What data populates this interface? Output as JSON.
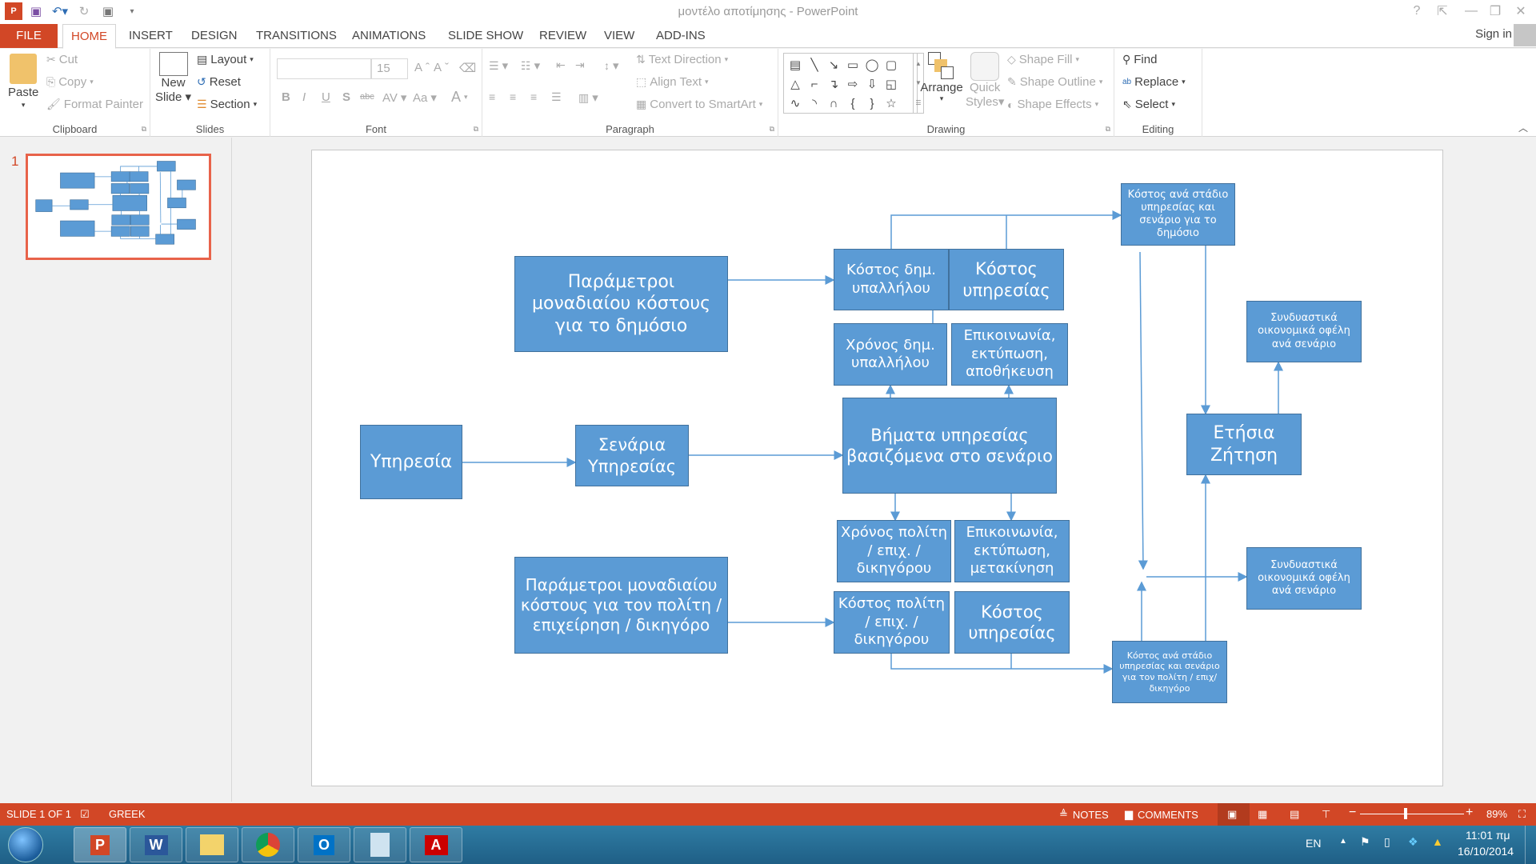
{
  "app": {
    "window_title": "μοντέλο αποτίμησης - PowerPoint",
    "quick_access": [
      "powerpoint-logo-icon",
      "save-icon",
      "undo-icon",
      "redo-icon",
      "start-from-beginning-icon",
      "customize-qat-icon"
    ],
    "window_controls": {
      "help": "?",
      "ribbon_display": "⇱",
      "minimize": "—",
      "restore": "❐",
      "close": "✕"
    },
    "sign_in": "Sign in"
  },
  "tabs": [
    {
      "label": "FILE"
    },
    {
      "label": "HOME",
      "active": true
    },
    {
      "label": "INSERT"
    },
    {
      "label": "DESIGN"
    },
    {
      "label": "TRANSITIONS"
    },
    {
      "label": "ANIMATIONS"
    },
    {
      "label": "SLIDE SHOW"
    },
    {
      "label": "REVIEW"
    },
    {
      "label": "VIEW"
    },
    {
      "label": "ADD-INS"
    }
  ],
  "ribbon": {
    "clipboard": {
      "label": "Clipboard",
      "paste": "Paste",
      "cut": "Cut",
      "copy": "Copy",
      "format_painter": "Format Painter"
    },
    "slides": {
      "label": "Slides",
      "new_slide_1": "New",
      "new_slide_2": "Slide",
      "layout": "Layout",
      "reset": "Reset",
      "section": "Section"
    },
    "font": {
      "label": "Font",
      "font_name": "",
      "font_size": "15",
      "bold": "B",
      "italic": "I",
      "underline": "U",
      "shadow": "S",
      "strike": "abc",
      "spacing": "AV",
      "case": "Aa",
      "color": "A",
      "grow": "A",
      "shrink": "A"
    },
    "paragraph": {
      "label": "Paragraph",
      "text_direction": "Text Direction",
      "align_text": "Align Text",
      "convert_smartart": "Convert to SmartArt"
    },
    "drawing": {
      "label": "Drawing",
      "arrange": "Arrange",
      "quick_styles_1": "Quick",
      "quick_styles_2": "Styles",
      "shape_fill": "Shape Fill",
      "shape_outline": "Shape Outline",
      "shape_effects": "Shape Effects",
      "shapes": [
        "▤",
        "╲",
        "↘",
        "▭",
        "◯",
        "▢",
        "△",
        "⌐",
        "↴",
        "⇨",
        "⇩",
        "◱",
        "∿",
        "◝",
        "∩",
        "{",
        "}",
        "☆"
      ]
    },
    "editing": {
      "label": "Editing",
      "find": "Find",
      "replace": "Replace",
      "select": "Select"
    }
  },
  "thumbnails": [
    {
      "number": "1",
      "selected": true
    }
  ],
  "diagram": {
    "boxes": {
      "ypiresia": "Υπηρεσία",
      "senaria": "Σενάρια Υπηρεσίας",
      "params_public": "Παράμετροι μοναδιαίου κόστους για το δημόσιο",
      "params_citizen": "Παράμετροι μοναδιαίου κόστους για τον πολίτη / επιχείρηση / δικηγόρο",
      "steps": "Βήματα υπηρεσίας βασιζόμενα στο σενάριο",
      "cost_employee": "Κόστος δημ. υπαλλήλου",
      "cost_service_top": "Κόστος υπηρεσίας",
      "time_employee": "Χρόνος δημ. υπαλλήλου",
      "comm_storage": "Επικοινωνία, εκτύπωση, αποθήκευση",
      "time_citizen": "Χρόνος πολίτη / επιχ. / δικηγόρου",
      "comm_travel": "Επικοινωνία, εκτύπωση, μετακίνηση",
      "cost_citizen": "Κόστος πολίτη / επιχ. / δικηγόρου",
      "cost_service_bottom": "Κόστος υπηρεσίας",
      "cost_stage_public": "Κόστος ανά στάδιο υπηρεσίας και σενάριο για το δημόσιο",
      "cost_stage_citizen": "Κόστος ανά στάδιο υπηρεσίας και σενάριο για τον πολίτη / επιχ/ δικηγόρο",
      "annual_demand": "Ετήσια Ζήτηση",
      "benefits_top": "Συνδυαστικά οικονομικά οφέλη ανά σενάριο",
      "benefits_bottom": "Συνδυαστικά οικονομικά οφέλη ανά σενάριο"
    },
    "colors": {
      "box_fill": "#5b9bd5",
      "box_border": "#41719c",
      "connector": "#5b9bd5"
    }
  },
  "statusbar": {
    "slide_info": "SLIDE 1 OF 1",
    "language": "GREEK",
    "notes": "NOTES",
    "comments": "COMMENTS",
    "zoom_percent": "89%",
    "zoom_level": 0.89
  },
  "taskbar": {
    "apps": [
      "PowerPoint",
      "Word",
      "Windows Explorer",
      "Chrome",
      "Outlook",
      "Calculator",
      "Adobe Reader"
    ],
    "language": "EN",
    "time": "11:01 πμ",
    "date": "16/10/2014"
  },
  "accent_color": "#d24726"
}
